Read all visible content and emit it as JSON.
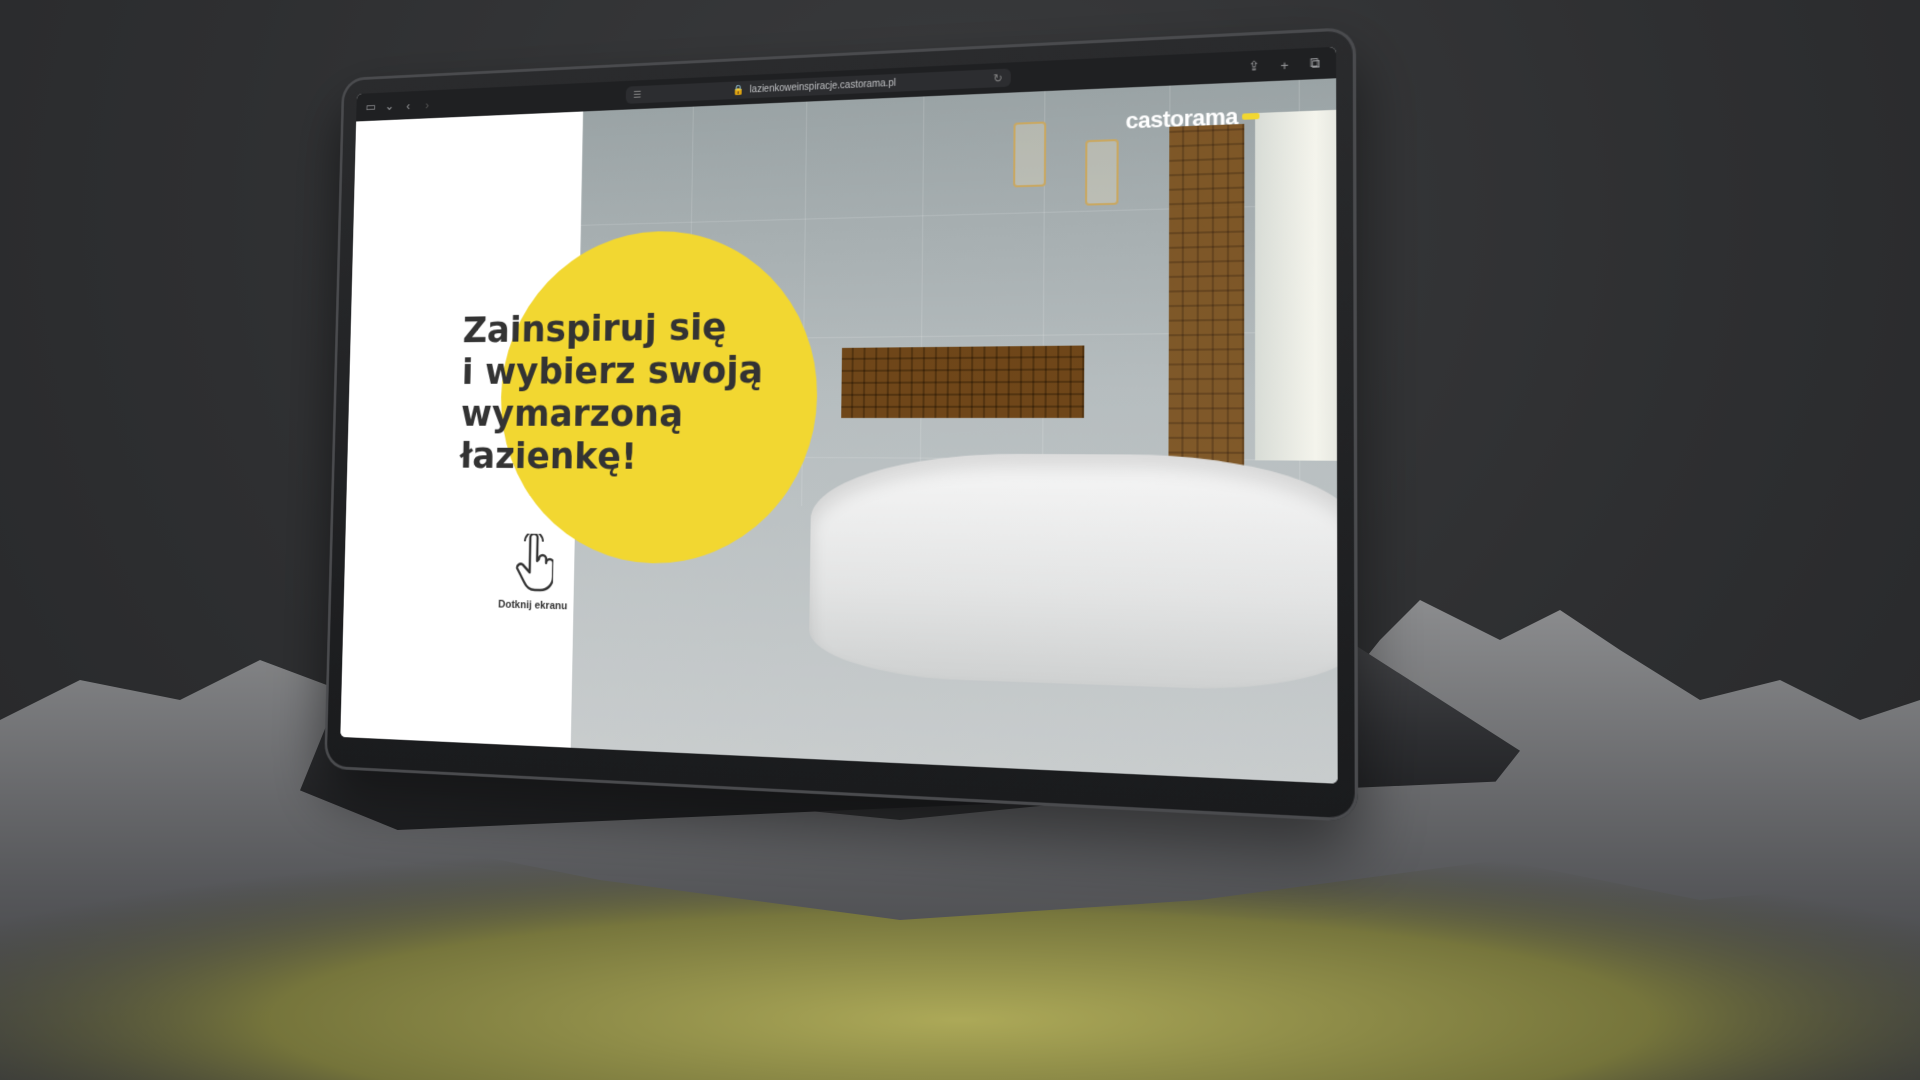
{
  "browser": {
    "url": "lazienkoweinspiracje.castorama.pl",
    "icons": [
      "sidebar-icon",
      "chevron-down-icon",
      "back-icon",
      "forward-icon",
      "reader-icon",
      "lock-icon",
      "reload-icon",
      "share-icon",
      "new-tab-icon",
      "tabs-icon"
    ]
  },
  "page": {
    "logo": "castorama",
    "headline": [
      "Zainspiruj się",
      "i wybierz swoją",
      "wymarzoną",
      "łazienkę!"
    ],
    "touch_label": "Dotknij ekranu"
  },
  "colors": {
    "accent": "#f2d731",
    "text": "#333333",
    "background": "#2e2f31"
  }
}
